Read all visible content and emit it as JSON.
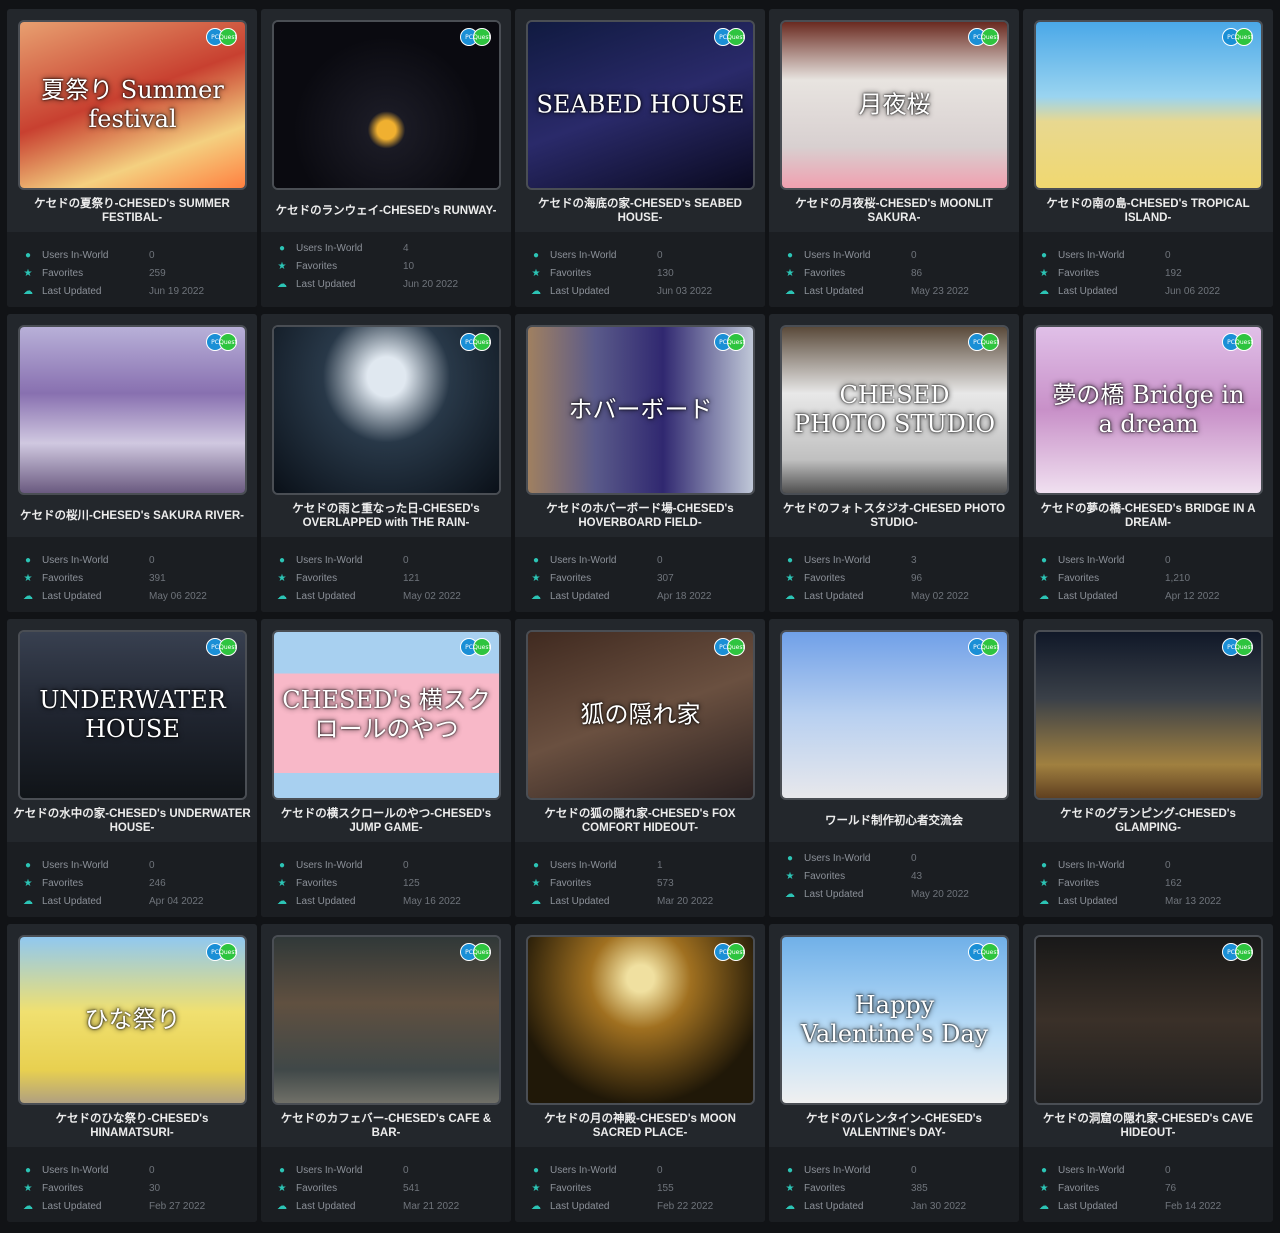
{
  "labels": {
    "users": "Users In-World",
    "favorites": "Favorites",
    "updated": "Last Updated"
  },
  "platform_badges": {
    "pc": "PC",
    "quest": "Quest"
  },
  "icons": {
    "users": "user-icon",
    "favorites": "star-icon",
    "updated": "cloud-upload-icon"
  },
  "colors": {
    "accent": "#2cc4b5",
    "pc_badge": "#1a8fd6",
    "quest_badge": "#2ec43f"
  },
  "worlds": [
    {
      "name": "ケセドの夏祭り-CHESED's SUMMER FESTIBAL-",
      "thumb_text": "夏祭り Summer festival",
      "users": "0",
      "favorites": "259",
      "updated": "Jun 19 2022",
      "bg": "linear-gradient(160deg,#e8a070,#c84030 45%,#f4d080 75%,#ff8040)"
    },
    {
      "name": "ケセドのランウェイ-CHESED's RUNWAY-",
      "thumb_text": "",
      "users": "4",
      "favorites": "10",
      "updated": "Jun 20 2022",
      "bg": "radial-gradient(circle at 50% 65%,#f0b030 0 6%,#1a1a24 12%,#0a0a10 60%),linear-gradient(#1c1c28,#000)"
    },
    {
      "name": "ケセドの海底の家-CHESED's SEABED HOUSE-",
      "thumb_text": "SEABED HOUSE",
      "users": "0",
      "favorites": "130",
      "updated": "Jun 03 2022",
      "bg": "linear-gradient(160deg,#101a40,#2a2a6a 50%,#0a0a20)"
    },
    {
      "name": "ケセドの月夜桜-CHESED's MOONLIT SAKURA-",
      "thumb_text": "月夜桜",
      "users": "0",
      "favorites": "86",
      "updated": "May 23 2022",
      "bg": "linear-gradient(180deg,#6a2a20,#e8e4e0 35%,#d8d0d0 75%,#f0a0b0)"
    },
    {
      "name": "ケセドの南の島-CHESED's TROPICAL ISLAND-",
      "thumb_text": "",
      "users": "0",
      "favorites": "192",
      "updated": "Jun 06 2022",
      "bg": "linear-gradient(180deg,#4aa8e8,#9ad4f0 45%,#e8d890 60%,#f0d870)"
    },
    {
      "name": "ケセドの桜川-CHESED's SAKURA RIVER-",
      "thumb_text": "",
      "users": "0",
      "favorites": "391",
      "updated": "May 06 2022",
      "bg": "linear-gradient(180deg,#b8b0d8,#8870b0 40%,#d0c8e0 70%,#6a5a80)"
    },
    {
      "name": "ケセドの雨と重なった日-CHESED's OVERLAPPED with THE RAIN-",
      "thumb_text": "",
      "users": "0",
      "favorites": "121",
      "updated": "May 02 2022",
      "bg": "radial-gradient(ellipse at 50% 30%,#e0e8f0 0 12%,#283848 40%,#0a1018),linear-gradient(#000,#102030)"
    },
    {
      "name": "ケセドのホバーボード場-CHESED's HOVERBOARD FIELD-",
      "thumb_text": "ホバーボード",
      "users": "0",
      "favorites": "307",
      "updated": "Apr 18 2022",
      "bg": "linear-gradient(90deg,#a08060,#5a5a8a 30%,#302870 60%,#c0c8d8)"
    },
    {
      "name": "ケセドのフォトスタジオ-CHESED PHOTO STUDIO-",
      "thumb_text": "CHESED PHOTO STUDIO",
      "users": "3",
      "favorites": "96",
      "updated": "May 02 2022",
      "bg": "linear-gradient(180deg,#5a4a3a,#e8e8e8 40%,#c0c0c0 80%,#505050)"
    },
    {
      "name": "ケセドの夢の橋-CHESED's BRIDGE IN A DREAM-",
      "thumb_text": "夢の橋 Bridge in a dream",
      "users": "0",
      "favorites": "1,210",
      "updated": "Apr 12 2022",
      "bg": "linear-gradient(180deg,#e0c0e8,#c890c8 50%,#f0e0f0)"
    },
    {
      "name": "ケセドの水中の家-CHESED's UNDERWATER HOUSE-",
      "thumb_text": "UNDERWATER HOUSE",
      "users": "0",
      "favorites": "246",
      "updated": "Apr 04 2022",
      "bg": "linear-gradient(180deg,#384050,#202530 50%,#101418)"
    },
    {
      "name": "ケセドの横スクロールのやつ-CHESED's JUMP GAME-",
      "thumb_text": "CHESED's 横スクロールのやつ",
      "users": "0",
      "favorites": "125",
      "updated": "May 16 2022",
      "bg": "linear-gradient(180deg,#a8d0f0 0 25%,#f8b8c8 25% 85%,#a8d0f0 85%)"
    },
    {
      "name": "ケセドの狐の隠れ家-CHESED's FOX COMFORT HIDEOUT-",
      "thumb_text": "狐の隠れ家",
      "users": "1",
      "favorites": "573",
      "updated": "Mar 20 2022",
      "bg": "linear-gradient(160deg,#402a20,#6a5040 50%,#2a2020)"
    },
    {
      "name": "ワールド制作初心者交流会",
      "thumb_text": "",
      "users": "0",
      "favorites": "43",
      "updated": "May 20 2022",
      "bg": "linear-gradient(180deg,#70a0e8,#b8d0f0 50%,#e8e8ec)"
    },
    {
      "name": "ケセドのグランピング-CHESED's GLAMPING-",
      "thumb_text": "",
      "users": "0",
      "favorites": "162",
      "updated": "Mar 13 2022",
      "bg": "linear-gradient(180deg,#101828,#3a4048 40%,#a08040 80%,#604020)"
    },
    {
      "name": "ケセドのひな祭り-CHESED's HINAMATSURI-",
      "thumb_text": "ひな祭り",
      "users": "0",
      "favorites": "30",
      "updated": "Feb 27 2022",
      "bg": "linear-gradient(180deg,#90c8f0,#f0e070 45%,#e8d050 80%,#b0a080)"
    },
    {
      "name": "ケセドのカフェバー-CHESED's CAFE & BAR-",
      "thumb_text": "",
      "users": "0",
      "favorites": "541",
      "updated": "Mar 21 2022",
      "bg": "linear-gradient(180deg,#303838,#605040 40%,#404848 80%,#707068)"
    },
    {
      "name": "ケセドの月の神殿-CHESED's MOON SACRED PLACE-",
      "thumb_text": "",
      "users": "0",
      "favorites": "155",
      "updated": "Feb 22 2022",
      "bg": "radial-gradient(circle at 50% 25%,#f0e0a0 0 8%,#a07020 30%,#201808 75%)"
    },
    {
      "name": "ケセドのバレンタイン-CHESED's VALENTINE's DAY-",
      "thumb_text": "Happy Valentine's Day",
      "users": "0",
      "favorites": "385",
      "updated": "Jan 30 2022",
      "bg": "linear-gradient(180deg,#70b0e8,#c0e0f8 60%,#f0f0f0)"
    },
    {
      "name": "ケセドの洞窟の隠れ家-CHESED's CAVE HIDEOUT-",
      "thumb_text": "",
      "users": "0",
      "favorites": "76",
      "updated": "Feb 14 2022",
      "bg": "linear-gradient(180deg,#181818,#3a3028 50%,#202020)"
    }
  ]
}
